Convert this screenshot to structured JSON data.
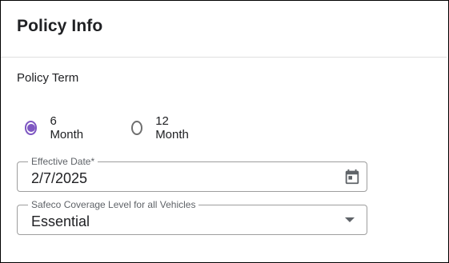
{
  "section": {
    "title": "Policy Info",
    "term_label": "Policy Term"
  },
  "policy_term": {
    "selected": "6 Month",
    "options": [
      {
        "label": "6 Month",
        "selected": true
      },
      {
        "label": "12 Month",
        "selected": false
      }
    ]
  },
  "effective_date": {
    "label": "Effective Date*",
    "value": "2/7/2025",
    "icon": "calendar-icon"
  },
  "coverage_level": {
    "label": "Safeco Coverage Level for all Vehicles",
    "value": "Essential",
    "icon": "dropdown-arrow-icon"
  },
  "colors": {
    "accent": "#7e57c2",
    "border": "#9e9e9e",
    "divider": "#e0e0e0"
  }
}
